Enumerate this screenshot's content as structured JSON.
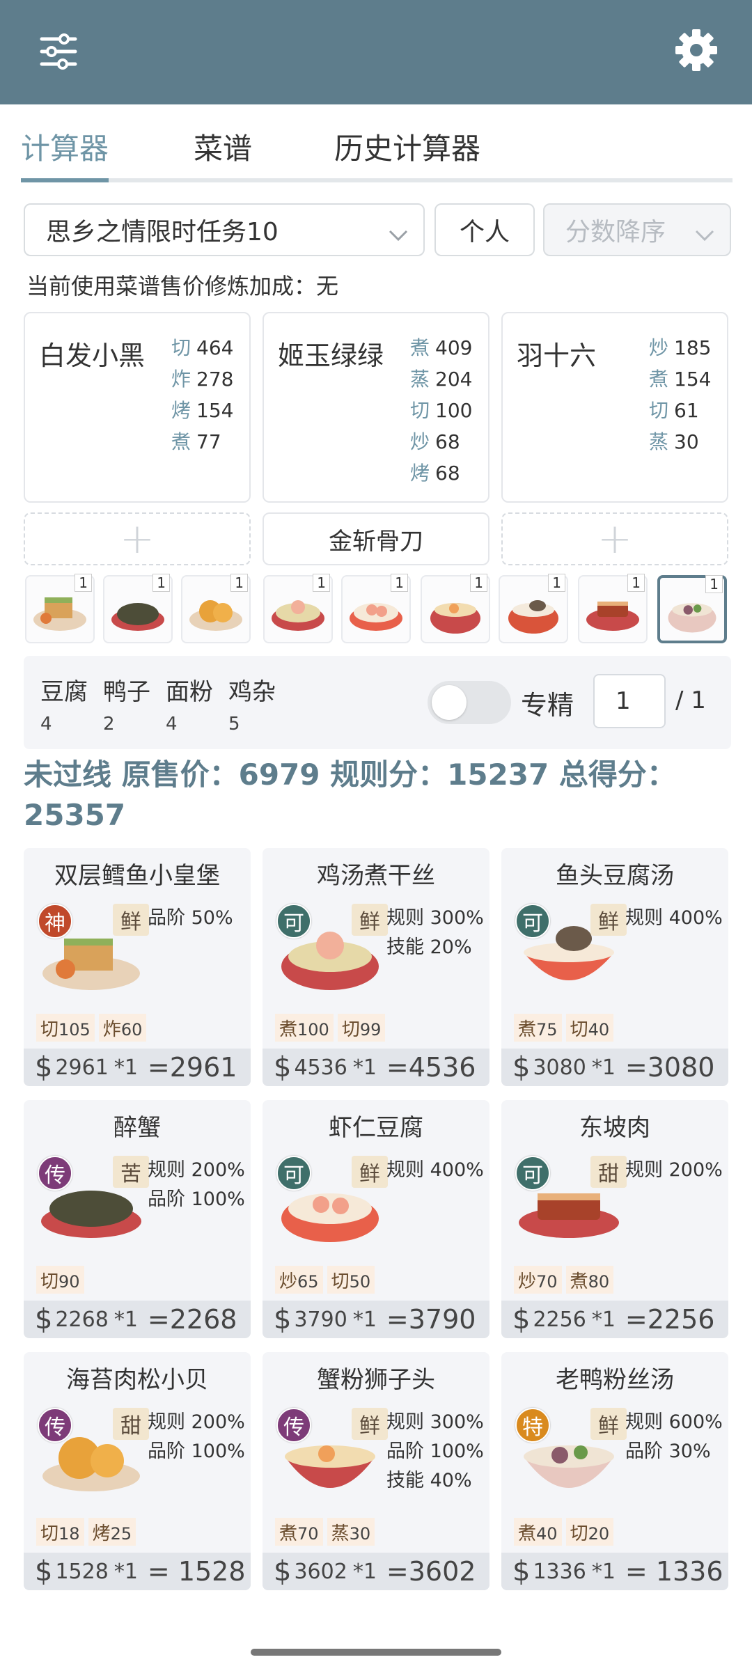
{
  "tabs": [
    {
      "label": "计算器",
      "active": true
    },
    {
      "label": "菜谱",
      "active": false
    },
    {
      "label": "历史计算器",
      "active": false
    }
  ],
  "filters": {
    "task": "思乡之情限时任务10",
    "mode": "个人",
    "sort": "分数降序"
  },
  "bonus_text": "当前使用菜谱售价修炼加成：无",
  "chefs": [
    {
      "name": "白发小黑",
      "skills": [
        {
          "k": "切",
          "v": "464"
        },
        {
          "k": "炸",
          "v": "278"
        },
        {
          "k": "烤",
          "v": "154"
        },
        {
          "k": "煮",
          "v": "77"
        }
      ]
    },
    {
      "name": "姬玉绿绿",
      "skills": [
        {
          "k": "煮",
          "v": "409"
        },
        {
          "k": "蒸",
          "v": "204"
        },
        {
          "k": "切",
          "v": "100"
        },
        {
          "k": "炒",
          "v": "68"
        },
        {
          "k": "烤",
          "v": "68"
        }
      ]
    },
    {
      "name": "羽十六",
      "skills": [
        {
          "k": "炒",
          "v": "185"
        },
        {
          "k": "煮",
          "v": "154"
        },
        {
          "k": "切",
          "v": "61"
        },
        {
          "k": "蒸",
          "v": "30"
        }
      ]
    }
  ],
  "equipment": {
    "middle": "金斩骨刀",
    "plus": "+"
  },
  "thumbs": [
    "1",
    "1",
    "1",
    "1",
    "1",
    "1",
    "1",
    "1",
    "1"
  ],
  "ingredients": [
    {
      "name": "豆腐",
      "count": "4"
    },
    {
      "name": "鸭子",
      "count": "2"
    },
    {
      "name": "面粉",
      "count": "4"
    },
    {
      "name": "鸡杂",
      "count": "5"
    }
  ],
  "specialize": {
    "label": "专精",
    "value": "1",
    "total": "/ 1",
    "enabled": false
  },
  "summary": "未过线 原售价：6979 规则分：15237 总得分：25357",
  "dishes": [
    {
      "name": "双层鳕鱼小皇堡",
      "rarity": "神",
      "rarity_color": "#c0492b",
      "flavor": "鲜",
      "bonuses": [
        "品阶 50%"
      ],
      "skills": [
        {
          "k": "切",
          "v": "105"
        },
        {
          "k": "炸",
          "v": "60"
        }
      ],
      "price": "2961",
      "mult": "*1",
      "total": "=2961"
    },
    {
      "name": "鸡汤煮干丝",
      "rarity": "可",
      "rarity_color": "#3f6f6a",
      "flavor": "鲜",
      "bonuses": [
        "规则 300%",
        "技能 20%"
      ],
      "skills": [
        {
          "k": "煮",
          "v": "100"
        },
        {
          "k": "切",
          "v": "99"
        }
      ],
      "price": "4536",
      "mult": "*1",
      "total": "=4536"
    },
    {
      "name": "鱼头豆腐汤",
      "rarity": "可",
      "rarity_color": "#3f6f6a",
      "flavor": "鲜",
      "bonuses": [
        "规则 400%"
      ],
      "skills": [
        {
          "k": "煮",
          "v": "75"
        },
        {
          "k": "切",
          "v": "40"
        }
      ],
      "price": "3080",
      "mult": "*1",
      "total": "=3080"
    },
    {
      "name": "醉蟹",
      "rarity": "传",
      "rarity_color": "#7d3b78",
      "flavor": "苦",
      "bonuses": [
        "规则 200%",
        "品阶 100%"
      ],
      "skills": [
        {
          "k": "切",
          "v": "90"
        }
      ],
      "price": "2268",
      "mult": "*1",
      "total": "=2268"
    },
    {
      "name": "虾仁豆腐",
      "rarity": "可",
      "rarity_color": "#3f6f6a",
      "flavor": "鲜",
      "bonuses": [
        "规则 400%"
      ],
      "skills": [
        {
          "k": "炒",
          "v": "65"
        },
        {
          "k": "切",
          "v": "50"
        }
      ],
      "price": "3790",
      "mult": "*1",
      "total": "=3790"
    },
    {
      "name": "东坡肉",
      "rarity": "可",
      "rarity_color": "#3f6f6a",
      "flavor": "甜",
      "bonuses": [
        "规则 200%"
      ],
      "skills": [
        {
          "k": "炒",
          "v": "70"
        },
        {
          "k": "煮",
          "v": "80"
        }
      ],
      "price": "2256",
      "mult": "*1",
      "total": "=2256"
    },
    {
      "name": "海苔肉松小贝",
      "rarity": "传",
      "rarity_color": "#7d3b78",
      "flavor": "甜",
      "bonuses": [
        "规则 200%",
        "品阶 100%"
      ],
      "skills": [
        {
          "k": "切",
          "v": "18"
        },
        {
          "k": "烤",
          "v": "25"
        }
      ],
      "price": "1528",
      "mult": "*1",
      "total": "= 1528"
    },
    {
      "name": "蟹粉狮子头",
      "rarity": "传",
      "rarity_color": "#7d3b78",
      "flavor": "鲜",
      "bonuses": [
        "规则 300%",
        "品阶 100%",
        "技能 40%"
      ],
      "skills": [
        {
          "k": "煮",
          "v": "70"
        },
        {
          "k": "蒸",
          "v": "30"
        }
      ],
      "price": "3602",
      "mult": "*1",
      "total": "=3602"
    },
    {
      "name": "老鸭粉丝汤",
      "rarity": "特",
      "rarity_color": "#d98a1e",
      "flavor": "鲜",
      "bonuses": [
        "规则 600%",
        "品阶 30%"
      ],
      "skills": [
        {
          "k": "煮",
          "v": "40"
        },
        {
          "k": "切",
          "v": "20"
        }
      ],
      "price": "1336",
      "mult": "*1",
      "total": "= 1336"
    }
  ],
  "colors": {
    "header": "#5e7d8c",
    "accent": "#6f95a6",
    "card_bg": "#f4f5f8"
  }
}
